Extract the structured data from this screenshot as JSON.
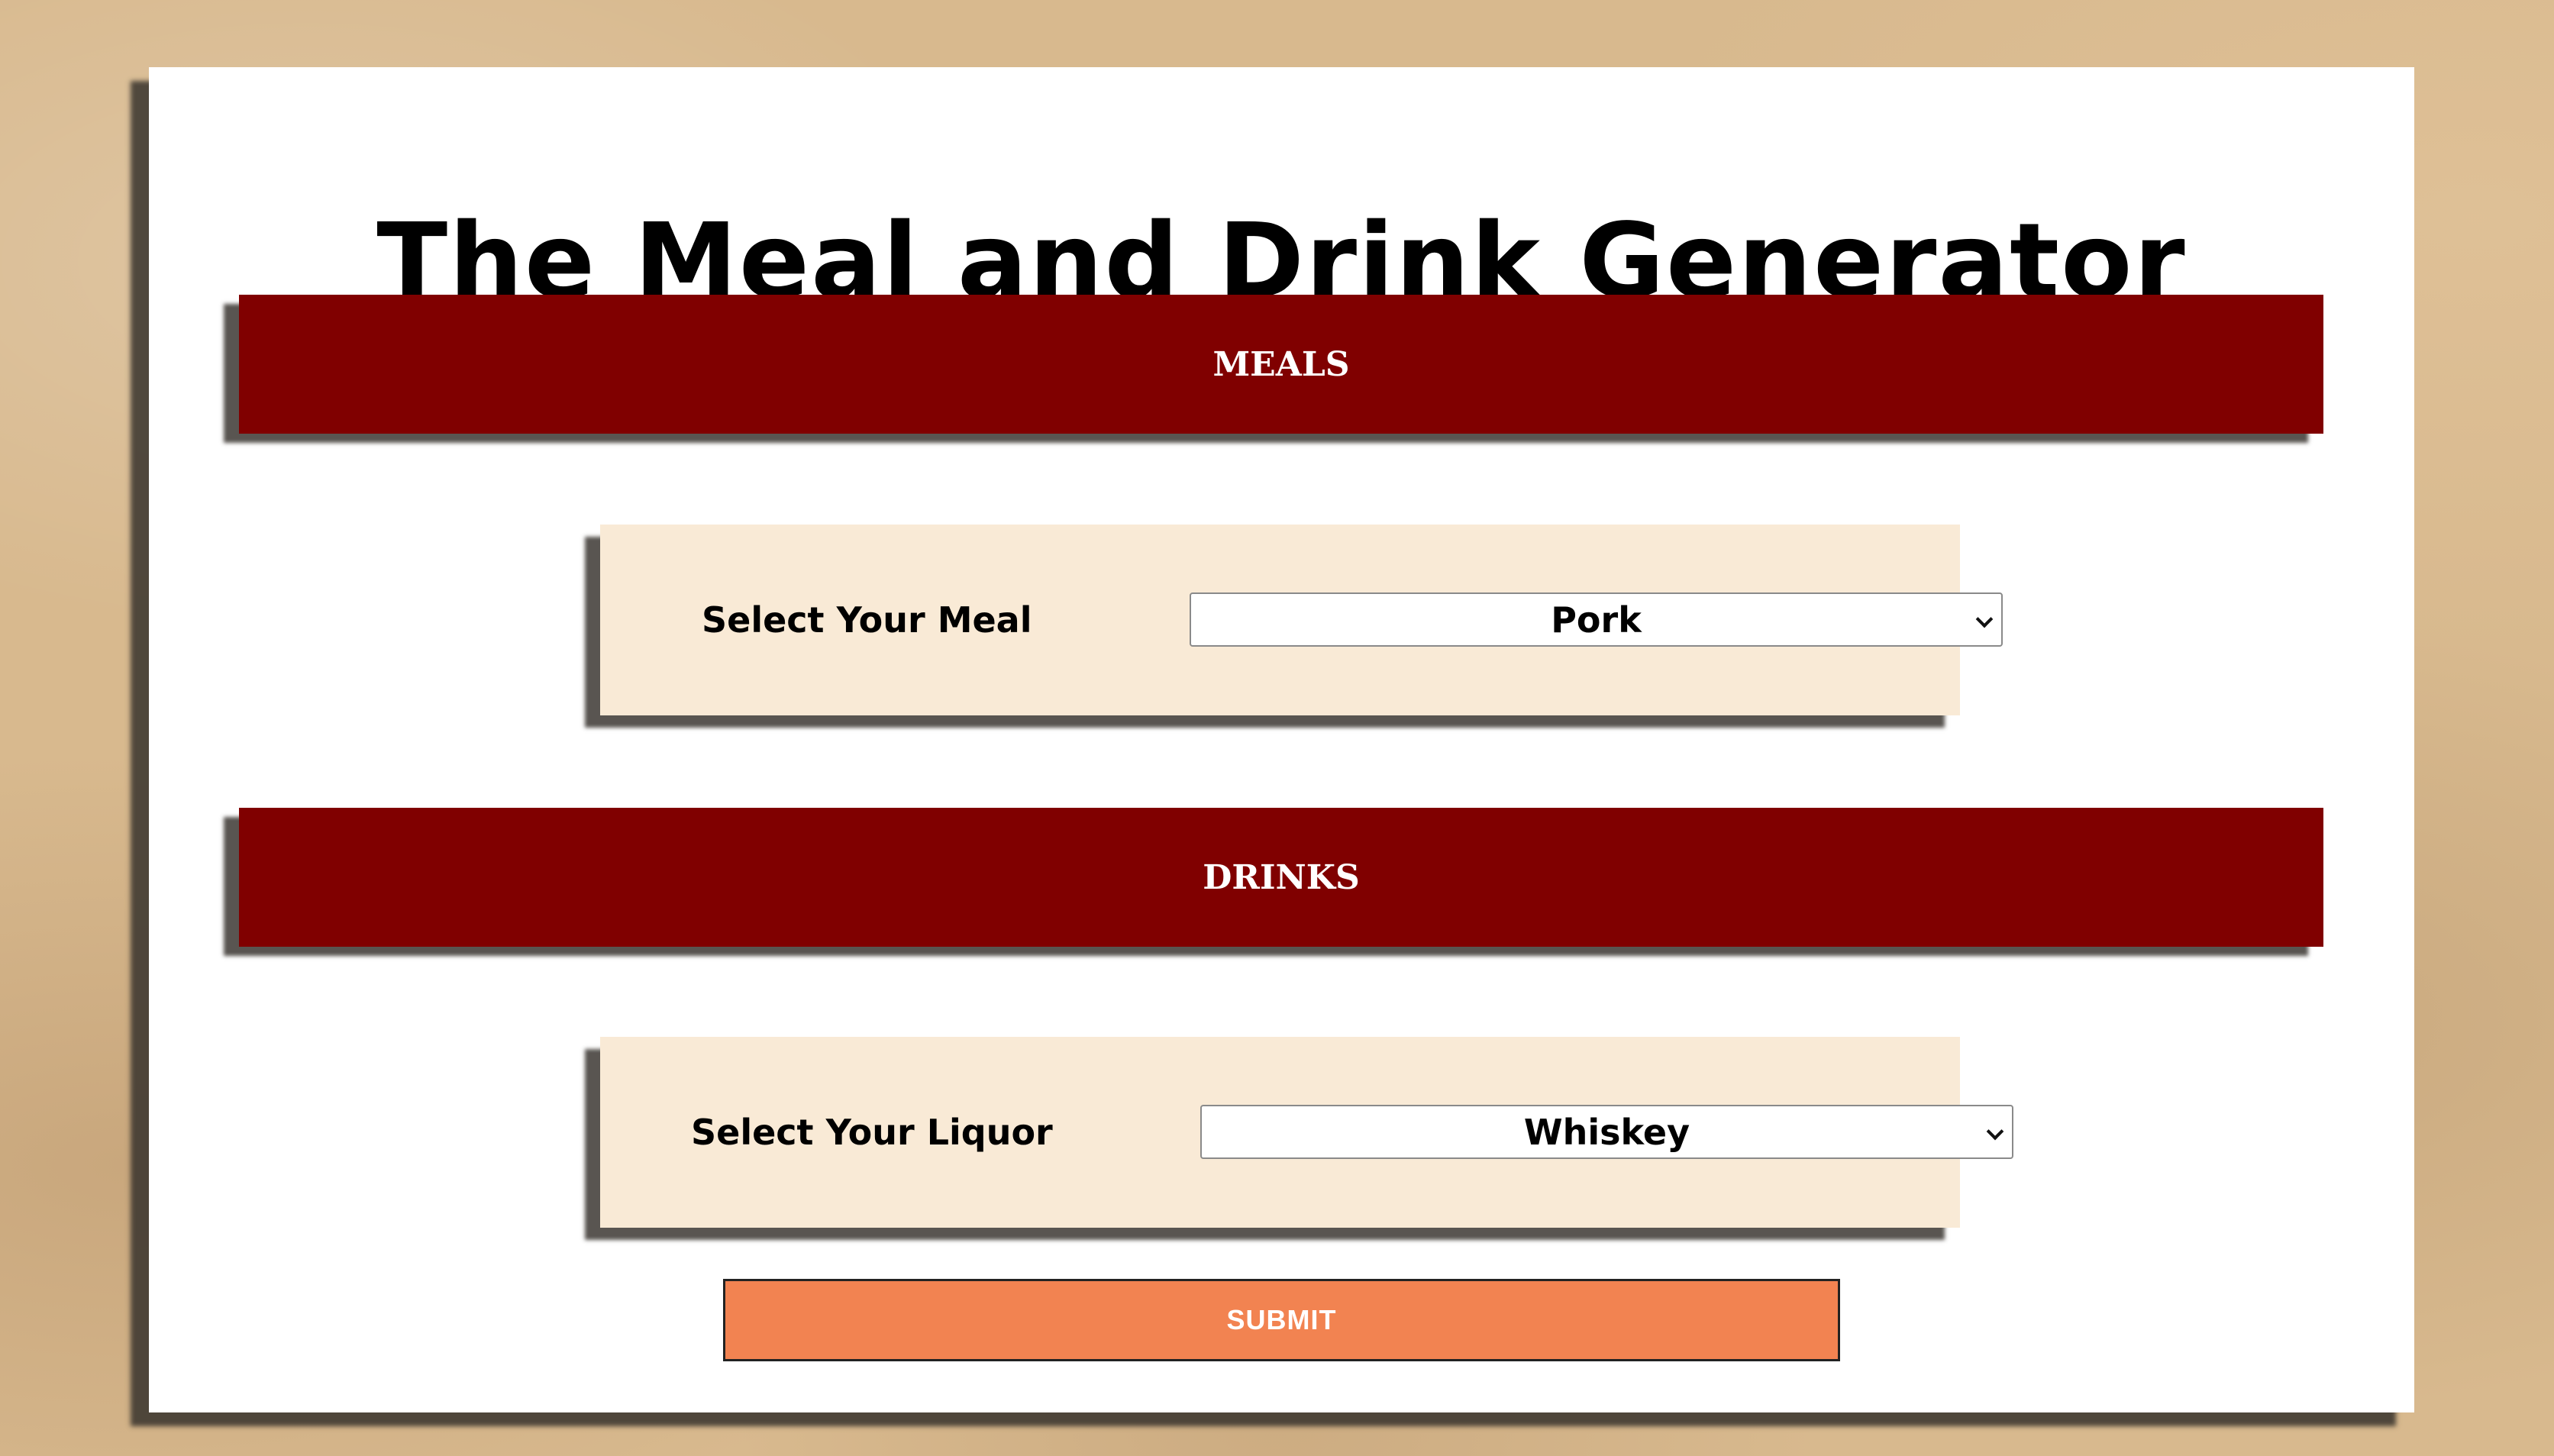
{
  "page": {
    "title": "The Meal and Drink Generator"
  },
  "meals_section": {
    "banner": "MEALS",
    "label": "Select Your Meal",
    "selected": "Pork"
  },
  "drinks_section": {
    "banner": "DRINKS",
    "label": "Select Your Liquor",
    "selected": "Whiskey"
  },
  "submit": {
    "label": "SUBMIT"
  },
  "colors": {
    "banner": "#800000",
    "panel": "#f9ead6",
    "submit": "#f28351",
    "card": "#ffffff",
    "background": "#d8b98e"
  },
  "icons": {
    "dropdown": "chevron-down-icon"
  }
}
